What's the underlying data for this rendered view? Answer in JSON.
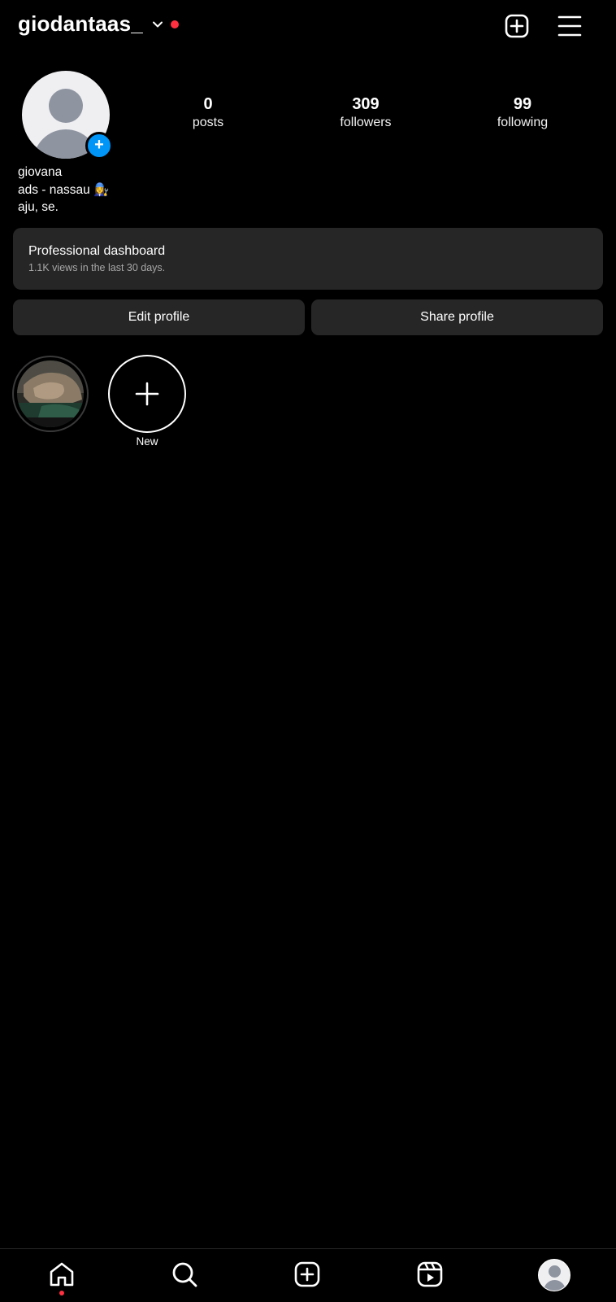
{
  "header": {
    "username": "giodantaas_",
    "create_icon": "plus-square-icon",
    "menu_icon": "hamburger-menu-icon"
  },
  "profile": {
    "stats": [
      {
        "value": "0",
        "label": "posts"
      },
      {
        "value": "309",
        "label": "followers"
      },
      {
        "value": "99",
        "label": "following"
      }
    ],
    "bio": {
      "name": "giovana",
      "line1": "ads - nassau 👩‍🔧",
      "line2": "aju, se."
    },
    "add_badge": "+"
  },
  "dashboard": {
    "title": "Professional dashboard",
    "subtitle": "1.1K views in the last 30 days."
  },
  "buttons": {
    "edit": "Edit profile",
    "share": "Share profile"
  },
  "highlights": {
    "new_label": "New"
  },
  "colors": {
    "background": "#000000",
    "surface": "#262626",
    "accent_blue": "#0095f6",
    "notification_red": "#ff3040"
  },
  "bottom_nav": [
    "home-icon",
    "search-icon",
    "create-icon",
    "reels-icon",
    "profile-avatar"
  ]
}
